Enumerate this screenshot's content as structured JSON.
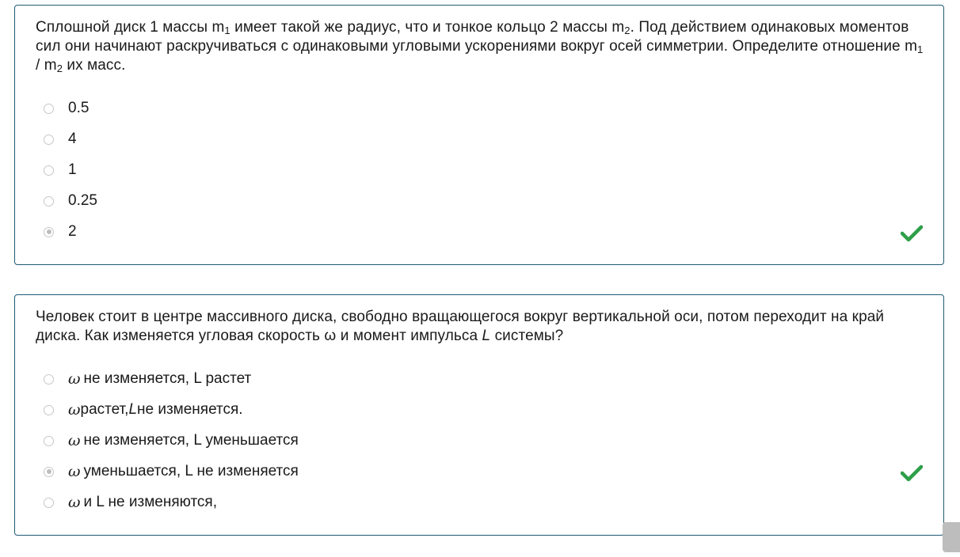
{
  "questions": [
    {
      "text_part1": "Сплошной диск 1 массы m",
      "sub1": "1",
      "text_part2": " имеет такой же радиус, что и тонкое кольцо 2 массы m",
      "sub2": "2",
      "text_part3": ". Под действием одинаковых моментов сил они начинают раскручиваться с одинаковыми угловыми ускорениями вокруг осей симметрии. Определите отношение m",
      "sub3": "1",
      "text_part4": " / m",
      "sub4": "2",
      "text_part5": "  их масс.",
      "options": [
        "0.5",
        "4",
        "1",
        "0.25",
        "2"
      ],
      "selected_index": 4,
      "status": "correct"
    },
    {
      "text_part1": "Человек стоит в центре массивного диска, свободно вращающегося вокруг вертикальной оси, потом переходит на край диска. Как изменяется угловая скорость ω и момент импульса ",
      "text_L": "L",
      "text_part2": " системы?",
      "omega_symbol": "ω",
      "options": [
        {
          "pre": "",
          "text": " не изменяется, L растет"
        },
        {
          "pre": "",
          "text": "растет, ",
          "ital": "L",
          "post": " не изменяется."
        },
        {
          "pre": "",
          "text": " не изменяется, L уменьшается"
        },
        {
          "pre": "",
          "text": " уменьшается, L не изменяется"
        },
        {
          "pre": "",
          "text": " и L не изменяются,"
        }
      ],
      "selected_index": 3,
      "status": "correct"
    }
  ],
  "colors": {
    "card_border": "#1f5a74",
    "check_green": "#2e9e49",
    "radio_border": "#c7c7c7"
  },
  "icons": {
    "correct": "checkmark-icon",
    "scroll": "scroll-to-top-button"
  }
}
